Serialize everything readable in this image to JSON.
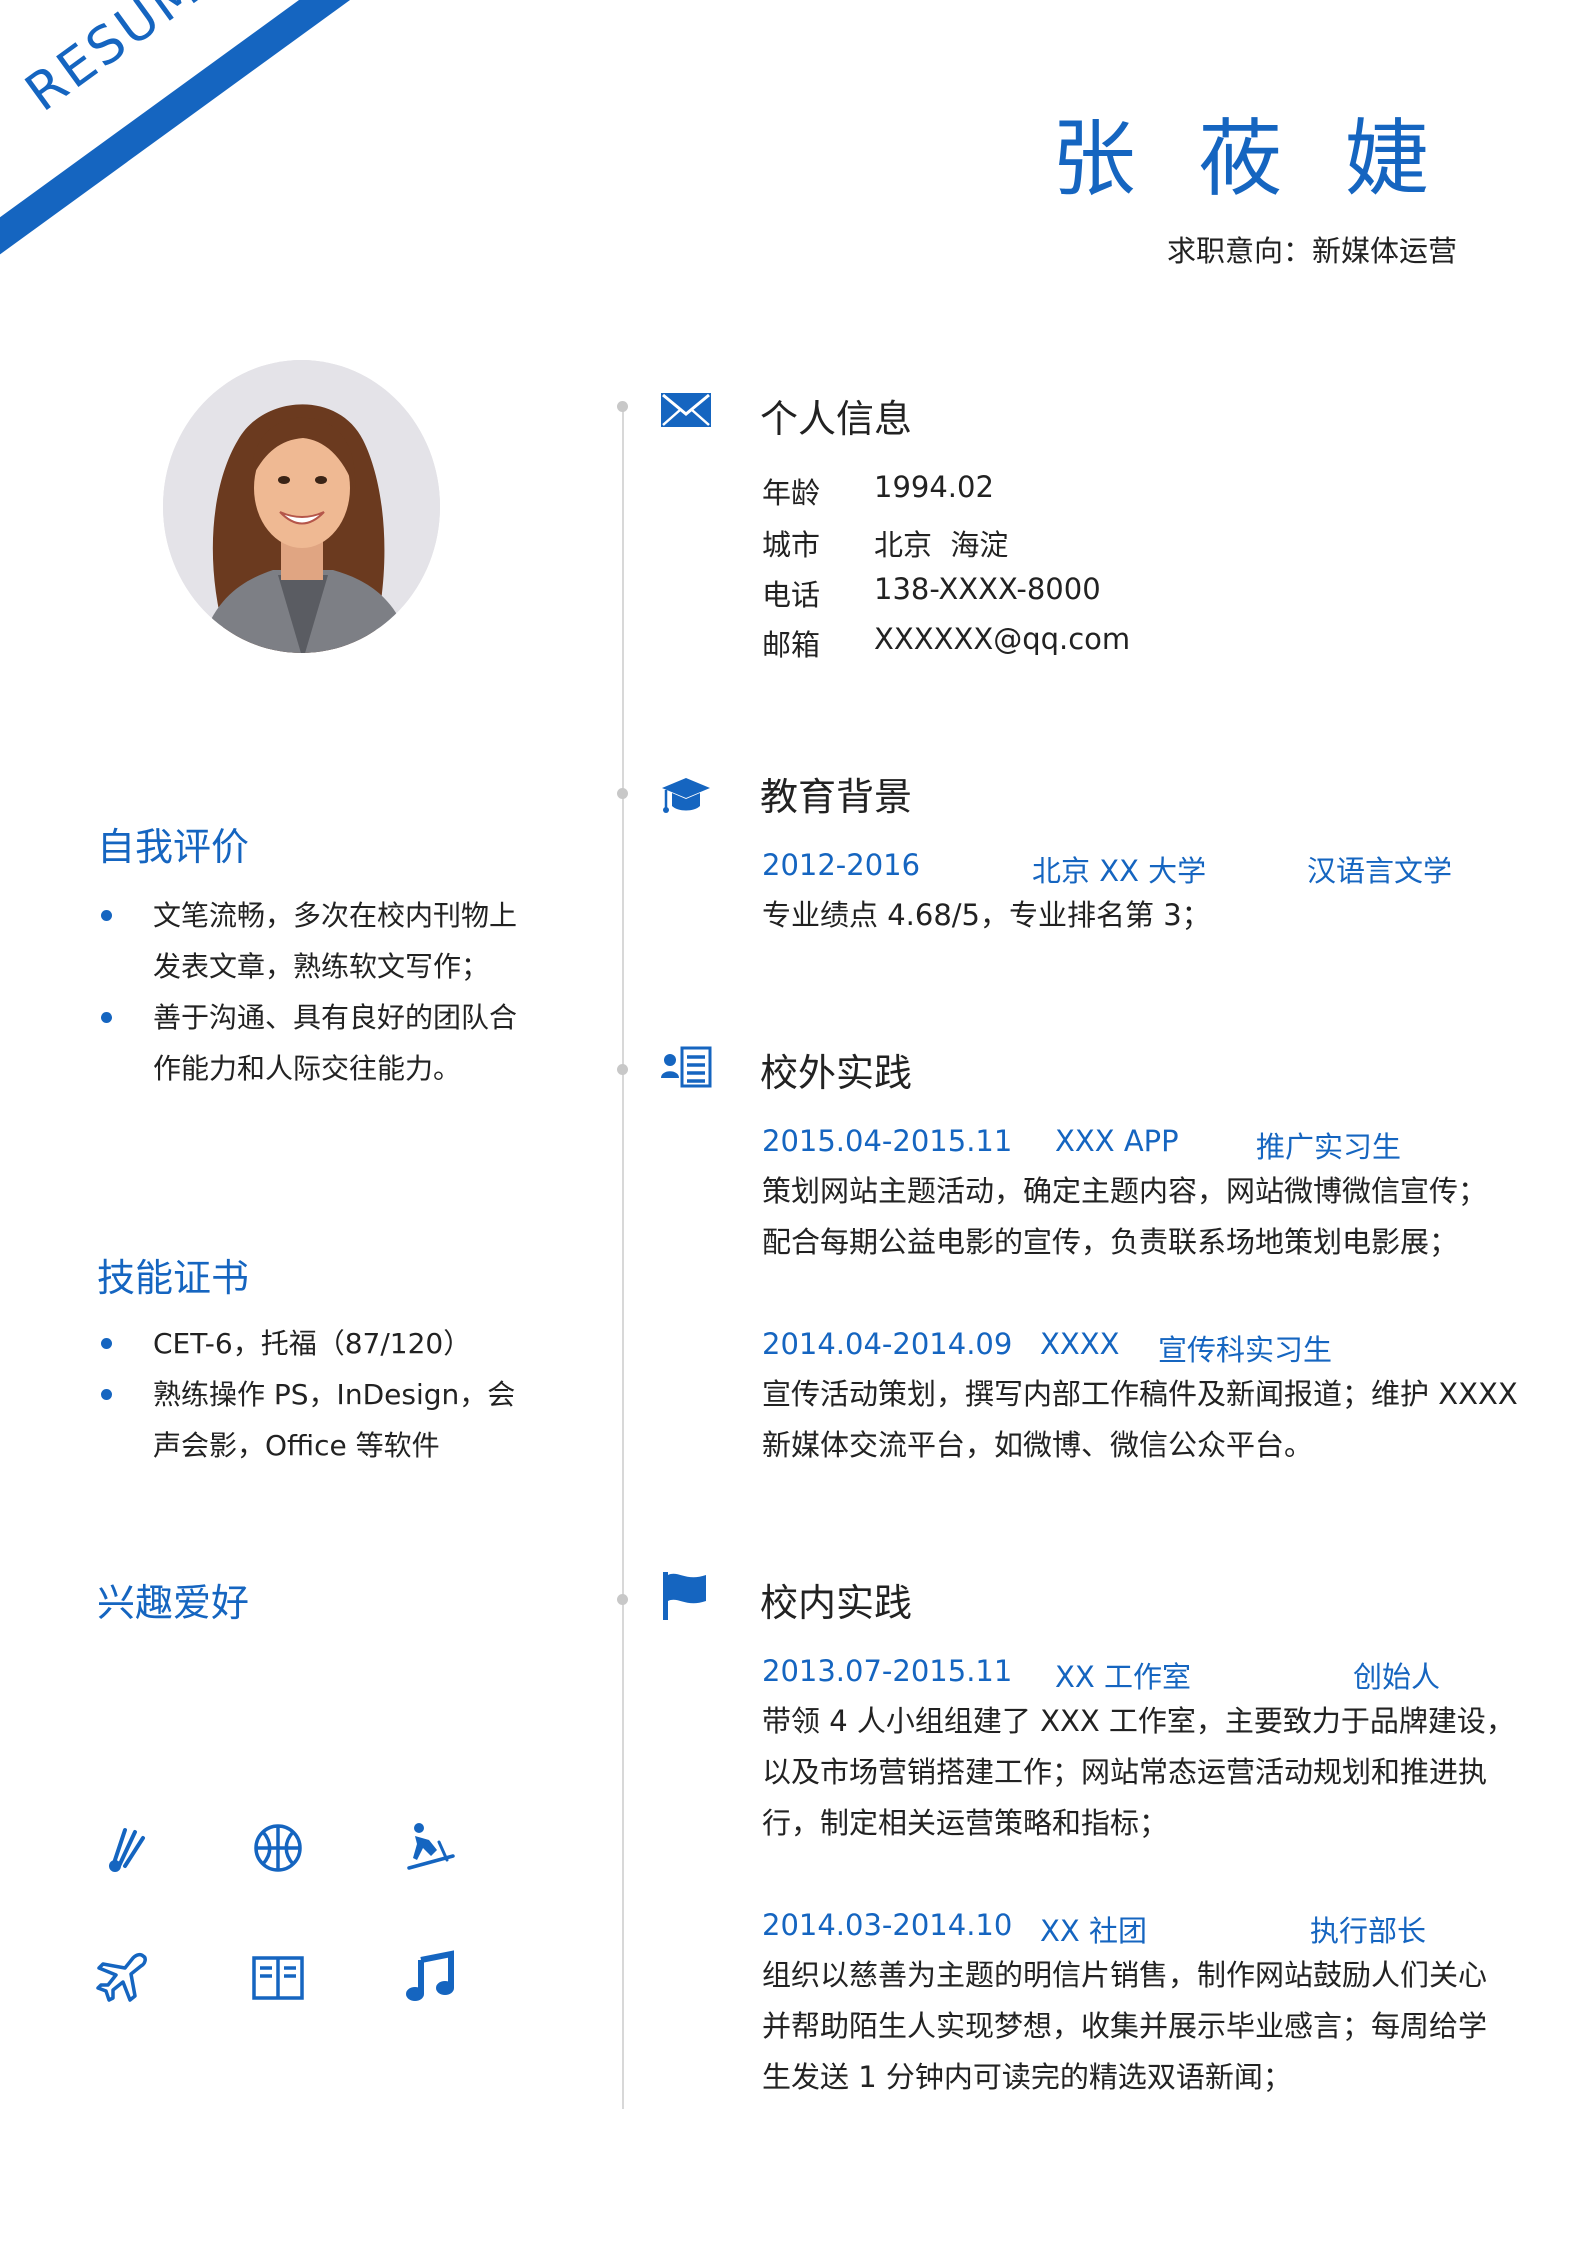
{
  "header": {
    "ribbon_text": "RESUME",
    "name": "张 莜 婕",
    "job_intent": "求职意向：新媒体运营"
  },
  "colors": {
    "accent": "#1565c0",
    "text": "#222222",
    "timeline": "#d8d8d8"
  },
  "left": {
    "self_eval": {
      "title": "自我评价",
      "items": [
        {
          "line1": "文笔流畅，多次在校内刊物上",
          "line2": "发表文章，熟练软文写作；"
        },
        {
          "line1": "善于沟通、具有良好的团队合",
          "line2": "作能力和人际交往能力。"
        }
      ]
    },
    "skills": {
      "title": "技能证书",
      "items": [
        {
          "line1": "CET-6，托福（87/120）",
          "line2": ""
        },
        {
          "line1": "熟练操作 PS，InDesign，会",
          "line2": "声会影，Office 等软件"
        }
      ]
    },
    "hobbies": {
      "title": "兴趣爱好",
      "icons": [
        "badminton-icon",
        "basketball-icon",
        "skiing-icon",
        "airplane-icon",
        "book-icon",
        "music-icon"
      ]
    }
  },
  "right": {
    "personal": {
      "title": "个人信息",
      "icon": "envelope-icon",
      "fields": [
        {
          "label": "年龄",
          "value": "1994.02"
        },
        {
          "label": "城市",
          "value": "北京  海淀"
        },
        {
          "label": "电话",
          "value": "138-XXXX-8000"
        },
        {
          "label": "邮箱",
          "value": "XXXXXX@qq.com"
        }
      ]
    },
    "education": {
      "title": "教育背景",
      "icon": "graduation-cap-icon",
      "period": "2012-2016",
      "school": "北京 XX 大学",
      "major": "汉语言文学",
      "detail": "专业绩点 4.68/5，专业排名第 3；"
    },
    "outside": {
      "title": "校外实践",
      "icon": "user-list-icon",
      "entries": [
        {
          "period": "2015.04-2015.11",
          "org": "XXX APP",
          "role": "推广实习生",
          "lines": [
            "策划网站主题活动，确定主题内容，网站微博微信宣传；",
            "配合每期公益电影的宣传，负责联系场地策划电影展；"
          ]
        },
        {
          "period": "2014.04-2014.09",
          "org": "XXXX",
          "role": "宣传科实习生",
          "lines": [
            "宣传活动策划，撰写内部工作稿件及新闻报道；维护 XXXX",
            "新媒体交流平台，如微博、微信公众平台。"
          ]
        }
      ]
    },
    "campus": {
      "title": "校内实践",
      "icon": "flag-icon",
      "entries": [
        {
          "period": "2013.07-2015.11",
          "org": "XX 工作室",
          "role": "创始人",
          "lines": [
            "带领 4 人小组组建了 XXX 工作室，主要致力于品牌建设，",
            "以及市场营销搭建工作；网站常态运营活动规划和推进执",
            "行，制定相关运营策略和指标；"
          ]
        },
        {
          "period": "2014.03-2014.10",
          "org": "XX 社团",
          "role": "执行部长",
          "lines": [
            "组织以慈善为主题的明信片销售，制作网站鼓励人们关心",
            "并帮助陌生人实现梦想，收集并展示毕业感言；每周给学",
            "生发送 1 分钟内可读完的精选双语新闻；"
          ]
        }
      ]
    }
  }
}
